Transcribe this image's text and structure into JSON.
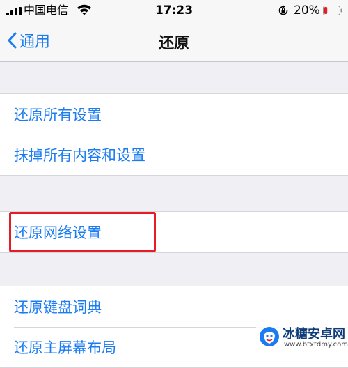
{
  "status_bar": {
    "carrier": "中国电信",
    "time": "17:23",
    "battery_percent": "20%",
    "battery_level": 0.2,
    "battery_color": "#e41c25"
  },
  "nav": {
    "back_label": "通用",
    "title": "还原"
  },
  "groups": [
    {
      "items": [
        "还原所有设置",
        "抹掉所有内容和设置"
      ]
    },
    {
      "items": [
        "还原网络设置"
      ]
    },
    {
      "items": [
        "还原键盘词典",
        "还原主屏幕布局"
      ]
    }
  ],
  "highlight_color": "#e41c25",
  "accent_color": "#1b7cf2",
  "watermark": {
    "name": "冰糖安卓网",
    "url": "www.btxtdmy.com"
  }
}
